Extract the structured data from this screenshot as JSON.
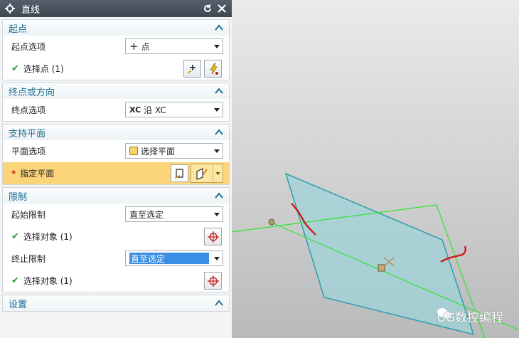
{
  "dialog": {
    "title": "直线",
    "icons": {
      "settings": "gear-icon",
      "reset": "reset-icon",
      "close": "close-icon"
    }
  },
  "start_point": {
    "header": "起点",
    "option_label": "起点选项",
    "option_value": "点",
    "select_label": "选择点 (1)"
  },
  "end_point": {
    "header": "终点或方向",
    "option_label": "终点选项",
    "option_prefix": "XC",
    "option_value": "沿 XC"
  },
  "support_plane": {
    "header": "支持平面",
    "option_label": "平面选项",
    "option_value": "选择平面",
    "specify_label": "指定平面",
    "required_mark": "*"
  },
  "limits": {
    "header": "限制",
    "start_label": "起始限制",
    "start_value": "直至选定",
    "start_select": "选择对象 (1)",
    "end_label": "终止限制",
    "end_value": "直至选定",
    "end_select": "选择对象 (1)"
  },
  "settings": {
    "header": "设置"
  },
  "watermark": "UG数控编程",
  "colors": {
    "header_text": "#1f6f93",
    "required_bg": "#fcd57a",
    "highlight": "#3a8ee6",
    "line_green": "#2ee62e",
    "plane_fill": "#9fd3d8",
    "plane_edge": "#2f9fa8",
    "annotation_red": "#d11a1a"
  }
}
